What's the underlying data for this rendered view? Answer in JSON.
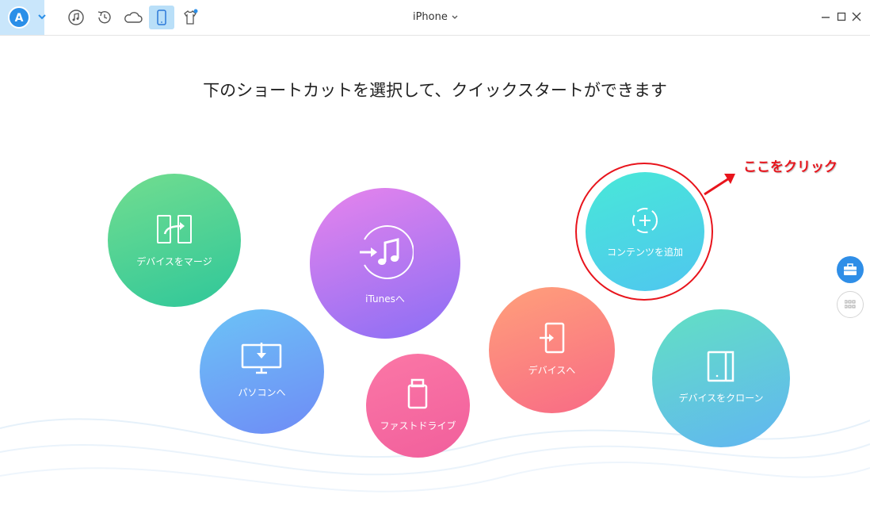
{
  "toolbar": {
    "device_name": "iPhone",
    "icons": [
      "app-logo",
      "music-icon",
      "restore-icon",
      "cloud-icon",
      "phone-icon",
      "shirt-icon"
    ],
    "window_controls": [
      "minimize",
      "maximize",
      "close"
    ]
  },
  "headline": "下のショートカットを選択して、クイックスタートができます",
  "shortcuts": [
    {
      "label": "デバイスをマージ",
      "icon": "merge-icon"
    },
    {
      "label": "iTunesへ",
      "icon": "itunes-icon"
    },
    {
      "label": "コンテンツを追加",
      "icon": "add-content-icon"
    },
    {
      "label": "パソコンへ",
      "icon": "monitor-icon"
    },
    {
      "label": "ファストドライブ",
      "icon": "usb-drive-icon"
    },
    {
      "label": "デバイスへ",
      "icon": "device-import-icon"
    },
    {
      "label": "デバイスをクローン",
      "icon": "clone-icon"
    }
  ],
  "annotation": {
    "text": "ここをクリック",
    "color": "#e8141c"
  },
  "side_buttons": [
    "toolbox-icon",
    "grid-icon"
  ],
  "colors": {
    "accent": "#2b8fe8",
    "annotation_red": "#e8141c"
  }
}
